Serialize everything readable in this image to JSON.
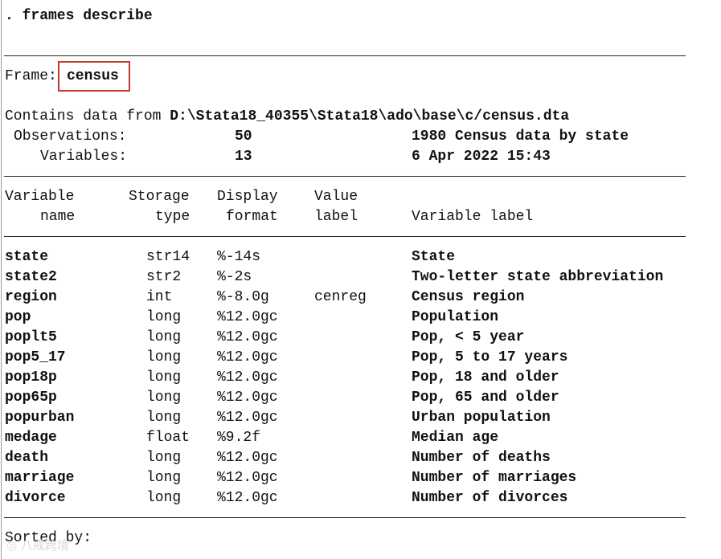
{
  "command": ". frames describe",
  "frame": {
    "label": "Frame:",
    "name": "census"
  },
  "contains": {
    "prefix": "Contains data from ",
    "path": "D:\\Stata18_40355\\Stata18\\ado\\base\\c/census.dta"
  },
  "observations": {
    "label": "Observations:",
    "value": "50",
    "note": "1980 Census data by state"
  },
  "variables": {
    "label": "Variables:",
    "value": "13",
    "note": "6 Apr 2022 15:43"
  },
  "headers": {
    "variable_1": "Variable",
    "variable_2": "name",
    "storage_1": "Storage",
    "storage_2": "type",
    "display_1": "Display",
    "display_2": "format",
    "value_1": "Value",
    "value_2": "label",
    "varlabel": "Variable label"
  },
  "rows": [
    {
      "name": "state",
      "type": "str14",
      "format": "%-14s",
      "vlabel": "",
      "label": "State"
    },
    {
      "name": "state2",
      "type": "str2",
      "format": "%-2s",
      "vlabel": "",
      "label": "Two-letter state abbreviation"
    },
    {
      "name": "region",
      "type": "int",
      "format": "%-8.0g",
      "vlabel": "cenreg",
      "label": "Census region"
    },
    {
      "name": "pop",
      "type": "long",
      "format": "%12.0gc",
      "vlabel": "",
      "label": "Population"
    },
    {
      "name": "poplt5",
      "type": "long",
      "format": "%12.0gc",
      "vlabel": "",
      "label": "Pop, < 5 year"
    },
    {
      "name": "pop5_17",
      "type": "long",
      "format": "%12.0gc",
      "vlabel": "",
      "label": "Pop, 5 to 17 years"
    },
    {
      "name": "pop18p",
      "type": "long",
      "format": "%12.0gc",
      "vlabel": "",
      "label": "Pop, 18 and older"
    },
    {
      "name": "pop65p",
      "type": "long",
      "format": "%12.0gc",
      "vlabel": "",
      "label": "Pop, 65 and older"
    },
    {
      "name": "popurban",
      "type": "long",
      "format": "%12.0gc",
      "vlabel": "",
      "label": "Urban population"
    },
    {
      "name": "medage",
      "type": "float",
      "format": "%9.2f",
      "vlabel": "",
      "label": "Median age"
    },
    {
      "name": "death",
      "type": "long",
      "format": "%12.0gc",
      "vlabel": "",
      "label": "Number of deaths"
    },
    {
      "name": "marriage",
      "type": "long",
      "format": "%12.0gc",
      "vlabel": "",
      "label": "Number of marriages"
    },
    {
      "name": "divorce",
      "type": "long",
      "format": "%12.0gc",
      "vlabel": "",
      "label": "Number of divorces"
    }
  ],
  "sorted_by": "Sorted by:",
  "watermark": "八戒跨境"
}
